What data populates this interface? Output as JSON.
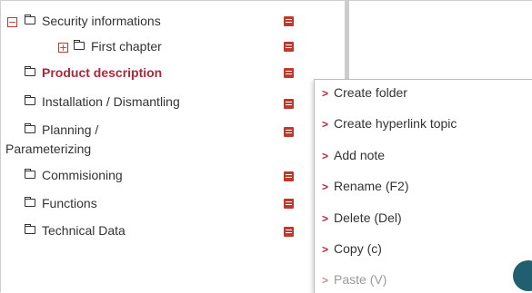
{
  "tree": {
    "items": [
      {
        "label": "Security informations",
        "expander": "−"
      },
      {
        "label": "First chapter",
        "expander": "+"
      },
      {
        "label": "Product description"
      },
      {
        "label": "Installation / Dismantling"
      },
      {
        "label": "Planning /",
        "label_line2": "Parameterizing"
      },
      {
        "label": "Commisioning"
      },
      {
        "label": "Functions"
      },
      {
        "label": "Technical Data"
      }
    ]
  },
  "context_menu": {
    "items": [
      {
        "label": "Create folder",
        "enabled": true
      },
      {
        "label": "Create hyperlink topic",
        "enabled": true
      },
      {
        "label": "Add note",
        "enabled": true
      },
      {
        "label": "Rename (F2)",
        "enabled": true
      },
      {
        "label": "Delete (Del)",
        "enabled": true
      },
      {
        "label": "Copy (c)",
        "enabled": true
      },
      {
        "label": "Paste (V)",
        "enabled": false
      }
    ],
    "chevron": ">"
  },
  "colors": {
    "accent": "#c0392b",
    "selected_text": "#b0263b",
    "fab": "#1f5f6f"
  }
}
